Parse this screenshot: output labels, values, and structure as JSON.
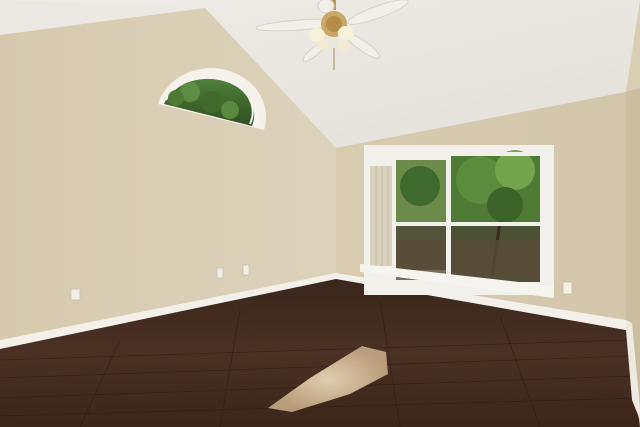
{
  "scene": {
    "description_visible_text": "",
    "colors": {
      "left_wall": "#d8ccb2",
      "back_wall": "#d9cdb3",
      "right_wall": "#cfc2a7",
      "ceiling_left": "#ece8e2",
      "ceiling_right": "#e6e2dc",
      "floor_dark": "#2e1d14",
      "floor_mid": "#4a3226",
      "baseboard": "#f4f1ea",
      "window_frame": "#f2f0ea",
      "foliage": "#3f6a2e",
      "sunlight": "#e8d3b0"
    },
    "icons": [
      "ceiling-fan-icon",
      "electrical-outlet-icon"
    ]
  }
}
